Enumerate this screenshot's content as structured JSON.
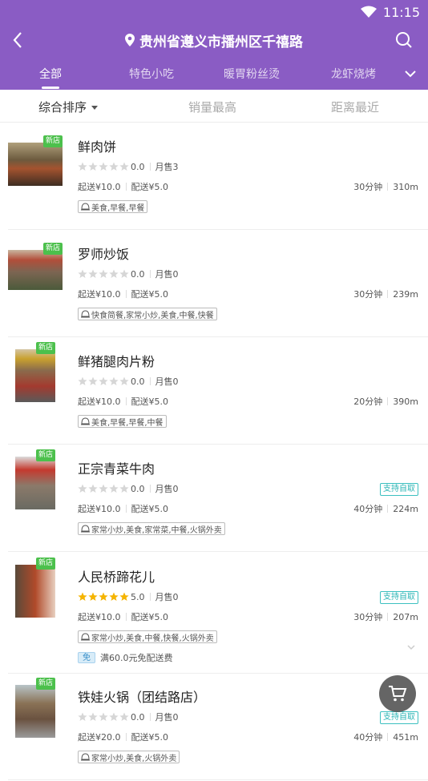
{
  "status": {
    "time": "11:15"
  },
  "header": {
    "location": "贵州省遵义市播州区千禧路"
  },
  "tabs": [
    "全部",
    "特色小吃",
    "暖胃粉丝烫",
    "龙虾烧烤"
  ],
  "sort": [
    "综合排序",
    "销量最高",
    "距离最近"
  ],
  "labels": {
    "new": "新店",
    "self_pickup": "支持自取",
    "free_badge": "免"
  },
  "shops": [
    {
      "name": "鲜肉饼",
      "rating": "0.0",
      "stars_filled": 0,
      "sales": "月售3",
      "min_order": "起送¥10.0",
      "delivery_fee": "配送¥5.0",
      "time": "30分钟",
      "distance": "310m",
      "categories": "美食,早餐,早餐",
      "self_pickup": false,
      "promo": ""
    },
    {
      "name": "罗师炒饭",
      "rating": "0.0",
      "stars_filled": 0,
      "sales": "月售0",
      "min_order": "起送¥10.0",
      "delivery_fee": "配送¥5.0",
      "time": "30分钟",
      "distance": "239m",
      "categories": "快食简餐,家常小炒,美食,中餐,快餐",
      "self_pickup": false,
      "promo": ""
    },
    {
      "name": "鲜猪腿肉片粉",
      "rating": "0.0",
      "stars_filled": 0,
      "sales": "月售0",
      "min_order": "起送¥10.0",
      "delivery_fee": "配送¥5.0",
      "time": "20分钟",
      "distance": "390m",
      "categories": "美食,早餐,早餐,中餐",
      "self_pickup": false,
      "promo": ""
    },
    {
      "name": "正宗青菜牛肉",
      "rating": "0.0",
      "stars_filled": 0,
      "sales": "月售0",
      "min_order": "起送¥10.0",
      "delivery_fee": "配送¥5.0",
      "time": "40分钟",
      "distance": "224m",
      "categories": "家常小炒,美食,家常菜,中餐,火锅外卖",
      "self_pickup": true,
      "promo": ""
    },
    {
      "name": "人民桥蹄花儿",
      "rating": "5.0",
      "stars_filled": 5,
      "sales": "月售0",
      "min_order": "起送¥10.0",
      "delivery_fee": "配送¥5.0",
      "time": "30分钟",
      "distance": "207m",
      "categories": "家常小炒,美食,中餐,快餐,火锅外卖",
      "self_pickup": true,
      "promo": "满60.0元免配送费"
    },
    {
      "name": "铁娃火锅（团结路店）",
      "rating": "0.0",
      "stars_filled": 0,
      "sales": "月售0",
      "min_order": "起送¥20.0",
      "delivery_fee": "配送¥5.0",
      "time": "40分钟",
      "distance": "451m",
      "categories": "家常小炒,美食,火锅外卖",
      "self_pickup": true,
      "promo": ""
    }
  ],
  "colors": {
    "brand": "#8a5cc4",
    "new_tag": "#4cc04c",
    "star": "#f5b400",
    "self_pickup": "#2cb6b6"
  }
}
